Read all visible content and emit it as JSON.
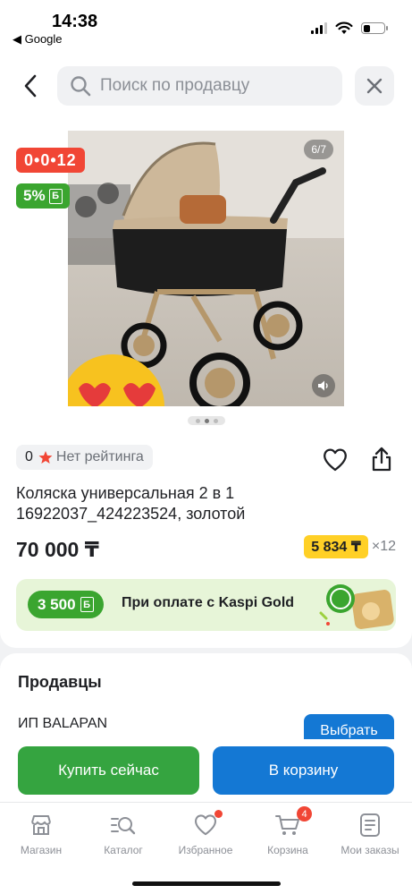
{
  "status_bar": {
    "time": "14:38",
    "back_app": "◀ Google"
  },
  "search": {
    "placeholder": "Поиск по продавцу"
  },
  "gallery": {
    "counter": "6/7",
    "current": 2,
    "total_dots": 3
  },
  "badges": {
    "timer": "0•0•12",
    "bonus_percent": "5%",
    "bonus_currency": "Б"
  },
  "product": {
    "rating_count": "0",
    "rating_text": "Нет рейтинга",
    "title": "Коляска универсальная 2 в 1 16922037_424223524, золотой",
    "price": "70 000 ₸",
    "monthly_amount": "5 834 ₸",
    "monthly_times": "×12"
  },
  "kaspi_gold": {
    "bonus": "3 500",
    "bonus_currency": "Б",
    "text": "При оплате с Kaspi Gold"
  },
  "sellers": {
    "title": "Продавцы",
    "seller_name": "ИП BALAPAN",
    "choose_label": "Выбрать"
  },
  "actions": {
    "buy_now": "Купить сейчас",
    "add_to_cart": "В корзину"
  },
  "tabbar": {
    "items": [
      {
        "label": "Магазин",
        "icon": "store-icon"
      },
      {
        "label": "Каталог",
        "icon": "catalog-search-icon"
      },
      {
        "label": "Избранное",
        "icon": "heart-icon",
        "dot": true
      },
      {
        "label": "Корзина",
        "icon": "cart-icon",
        "badge": "4"
      },
      {
        "label": "Мои заказы",
        "icon": "orders-icon"
      }
    ]
  },
  "colors": {
    "kaspi_green": "#35a440",
    "kaspi_blue": "#1478d4",
    "red": "#f14635",
    "yellow": "#ffd026"
  }
}
